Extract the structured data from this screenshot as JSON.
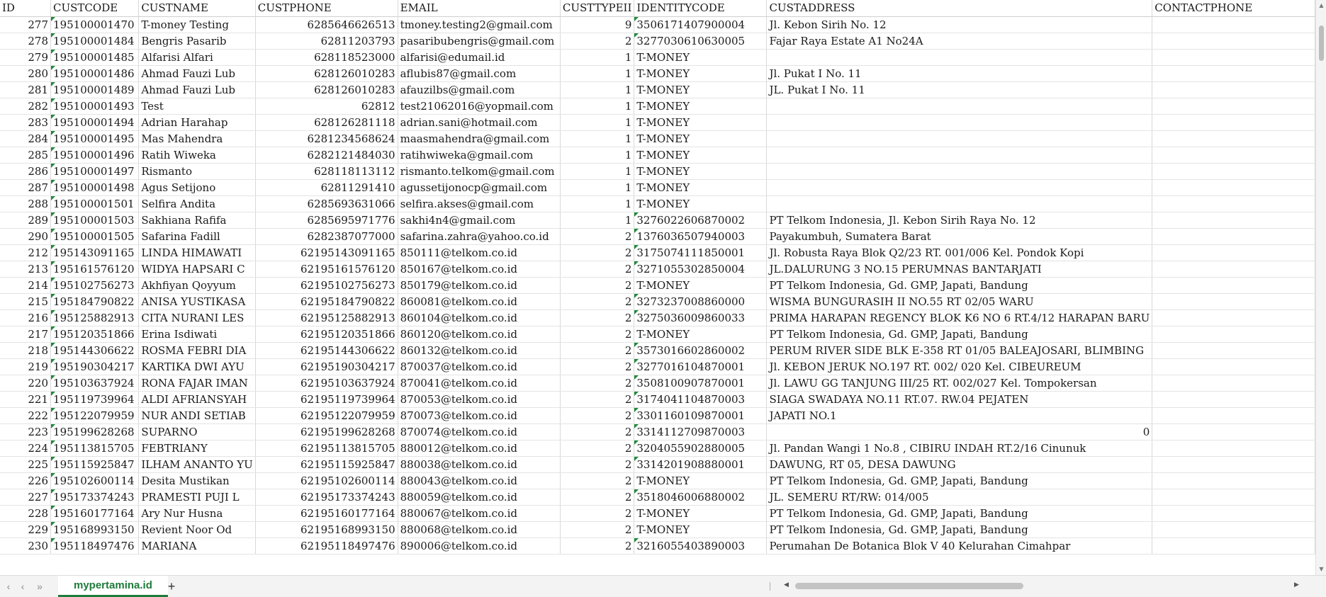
{
  "sheet": {
    "columns": [
      "ID",
      "CUSTCODE",
      "CUSTNAME",
      "CUSTPHONE",
      "EMAIL",
      "CUSTTYPEII",
      "IDENTITYCODE",
      "CUSTADDRESS",
      "CONTACTPHONE"
    ],
    "rows": [
      [
        "277",
        "195100001470",
        "T-money Testing",
        "6285646626513",
        "tmoney.testing2@gmail.com",
        "9",
        "3506171407900004",
        "Jl.  Kebon Sirih No.  12",
        ""
      ],
      [
        "278",
        "195100001484",
        "Bengris Pasarib",
        "62811203793",
        "pasaribubengris@gmail.com",
        "2",
        "3277030610630005",
        "Fajar Raya Estate A1 No24A",
        ""
      ],
      [
        "279",
        "195100001485",
        "Alfarisi Alfari",
        "628118523000",
        "alfarisi@edumail.id",
        "1",
        "T-MONEY",
        "",
        ""
      ],
      [
        "280",
        "195100001486",
        "Ahmad Fauzi Lub",
        "628126010283",
        "aflubis87@gmail.com",
        "1",
        "T-MONEY",
        "Jl.  Pukat I No.  11",
        ""
      ],
      [
        "281",
        "195100001489",
        "Ahmad Fauzi Lub",
        "628126010283",
        "afauzilbs@gmail.com",
        "1",
        "T-MONEY",
        "JL.  Pukat I No.  11",
        ""
      ],
      [
        "282",
        "195100001493",
        "Test",
        "62812",
        "test21062016@yopmail.com",
        "1",
        "T-MONEY",
        "",
        ""
      ],
      [
        "283",
        "195100001494",
        "Adrian Harahap",
        "628126281118",
        "adrian.sani@hotmail.com",
        "1",
        "T-MONEY",
        "",
        ""
      ],
      [
        "284",
        "195100001495",
        "Mas Mahendra",
        "6281234568624",
        "maasmahendra@gmail.com",
        "1",
        "T-MONEY",
        "",
        ""
      ],
      [
        "285",
        "195100001496",
        "Ratih Wiweka",
        "6282121484030",
        "ratihwiweka@gmail.com",
        "1",
        "T-MONEY",
        "",
        ""
      ],
      [
        "286",
        "195100001497",
        "Rismanto",
        "628118113112",
        "rismanto.telkom@gmail.com",
        "1",
        "T-MONEY",
        "",
        ""
      ],
      [
        "287",
        "195100001498",
        "Agus Setijono",
        "62811291410",
        "agussetijonocp@gmail.com",
        "1",
        "T-MONEY",
        "",
        ""
      ],
      [
        "288",
        "195100001501",
        "Selfira Andita",
        "6285693631066",
        "selfira.akses@gmail.com",
        "1",
        "T-MONEY",
        "",
        ""
      ],
      [
        "289",
        "195100001503",
        "Sakhiana Rafifa",
        "6285695971776",
        "sakhi4n4@gmail.com",
        "1",
        "3276022606870002",
        "PT Telkom Indonesia,  Jl.  Kebon Sirih Raya No.  12",
        ""
      ],
      [
        "290",
        "195100001505",
        "Safarina Fadill",
        "6282387077000",
        "safarina.zahra@yahoo.co.id",
        "2",
        "1376036507940003",
        "Payakumbuh,  Sumatera Barat",
        ""
      ],
      [
        "212",
        "195143091165",
        "LINDA HIMAWATI",
        "62195143091165",
        "850111@telkom.co.id",
        "2",
        "3175074111850001",
        "Jl.  Robusta Raya Blok Q2/23 RT.  001/006 Kel.  Pondok Kopi",
        ""
      ],
      [
        "213",
        "195161576120",
        "WIDYA HAPSARI C",
        "62195161576120",
        "850167@telkom.co.id",
        "2",
        "3271055302850004",
        "JL.DALURUNG 3 NO.15 PERUMNAS BANTARJATI",
        ""
      ],
      [
        "214",
        "195102756273",
        "Akhfiyan Qoyyum",
        "62195102756273",
        "850179@telkom.co.id",
        "2",
        "T-MONEY",
        "PT Telkom Indonesia,  Gd.  GMP,  Japati,  Bandung",
        ""
      ],
      [
        "215",
        "195184790822",
        "ANISA YUSTIKASA",
        "62195184790822",
        "860081@telkom.co.id",
        "2",
        "3273237008860000",
        "WISMA BUNGURASIH II NO.55 RT 02/05 WARU",
        ""
      ],
      [
        "216",
        "195125882913",
        "CITA NURANI LES",
        "62195125882913",
        "860104@telkom.co.id",
        "2",
        "3275036009860033",
        "PRIMA HARAPAN REGENCY BLOK K6 NO 6 RT.4/12 HARAPAN BARU",
        ""
      ],
      [
        "217",
        "195120351866",
        "Erina Isdiwati",
        "62195120351866",
        "860120@telkom.co.id",
        "2",
        "T-MONEY",
        "PT Telkom Indonesia,  Gd.  GMP,  Japati,  Bandung",
        ""
      ],
      [
        "218",
        "195144306622",
        "ROSMA FEBRI DIA",
        "62195144306622",
        "860132@telkom.co.id",
        "2",
        "3573016602860002",
        "PERUM RIVER SIDE BLK E-358 RT 01/05 BALEAJOSARI,  BLIMBING",
        ""
      ],
      [
        "219",
        "195190304217",
        "KARTIKA DWI AYU",
        "62195190304217",
        "870037@telkom.co.id",
        "2",
        "3277016104870001",
        "Jl.  KEBON JERUK NO.197 RT.  002/ 020 Kel.  CIBEUREUM",
        ""
      ],
      [
        "220",
        "195103637924",
        "RONA FAJAR IMAN",
        "62195103637924",
        "870041@telkom.co.id",
        "2",
        "3508100907870001",
        "Jl.  LAWU GG TANJUNG III/25 RT.  002/027 Kel.  Tompokersan",
        ""
      ],
      [
        "221",
        "195119739964",
        "ALDI AFRIANSYAH",
        "62195119739964",
        "870053@telkom.co.id",
        "2",
        "3174041104870003",
        "SIAGA SWADAYA NO.11 RT.07.  RW.04 PEJATEN",
        ""
      ],
      [
        "222",
        "195122079959",
        "NUR ANDI SETIAB",
        "62195122079959",
        "870073@telkom.co.id",
        "2",
        "3301160109870001",
        "JAPATI NO.1",
        ""
      ],
      [
        "223",
        "195199628268",
        "SUPARNO",
        "62195199628268",
        "870074@telkom.co.id",
        "2",
        "3314112709870003",
        "0",
        ""
      ],
      [
        "224",
        "195113815705",
        "FEBTRIANY",
        "62195113815705",
        "880012@telkom.co.id",
        "2",
        "3204055902880005",
        "Jl.  Pandan Wangi 1 No.8 ,  CIBIRU INDAH RT.2/16 Cinunuk",
        ""
      ],
      [
        "225",
        "195115925847",
        "ILHAM ANANTO YU",
        "62195115925847",
        "880038@telkom.co.id",
        "2",
        "3314201908880001",
        "DAWUNG,  RT 05,  DESA DAWUNG",
        ""
      ],
      [
        "226",
        "195102600114",
        "Desita Mustikan",
        "62195102600114",
        "880043@telkom.co.id",
        "2",
        "T-MONEY",
        "PT Telkom Indonesia,  Gd.  GMP,  Japati,  Bandung",
        ""
      ],
      [
        "227",
        "195173374243",
        "PRAMESTI PUJI L",
        "62195173374243",
        "880059@telkom.co.id",
        "2",
        "3518046006880002",
        "JL.  SEMERU RT/RW: 014/005",
        ""
      ],
      [
        "228",
        "195160177164",
        "Ary Nur Husna",
        "62195160177164",
        "880067@telkom.co.id",
        "2",
        "T-MONEY",
        "PT Telkom Indonesia,  Gd.  GMP,  Japati,  Bandung",
        ""
      ],
      [
        "229",
        "195168993150",
        "Revient Noor Od",
        "62195168993150",
        "880068@telkom.co.id",
        "2",
        "T-MONEY",
        "PT Telkom Indonesia,  Gd.  GMP,  Japati,  Bandung",
        ""
      ],
      [
        "230",
        "195118497476",
        "MARIANA",
        "62195118497476",
        "890006@telkom.co.id",
        "2",
        "3216055403890003",
        "Perumahan De Botanica Blok V 40 Kelurahan Cimahpar",
        ""
      ]
    ]
  },
  "sheet_tabs": {
    "active_label": "mypertamina.id",
    "add_label": "+"
  },
  "nav": {
    "first": "‹",
    "prev": "‹",
    "next": "›",
    "last": "»"
  },
  "accent_color": "#1e7b3a"
}
